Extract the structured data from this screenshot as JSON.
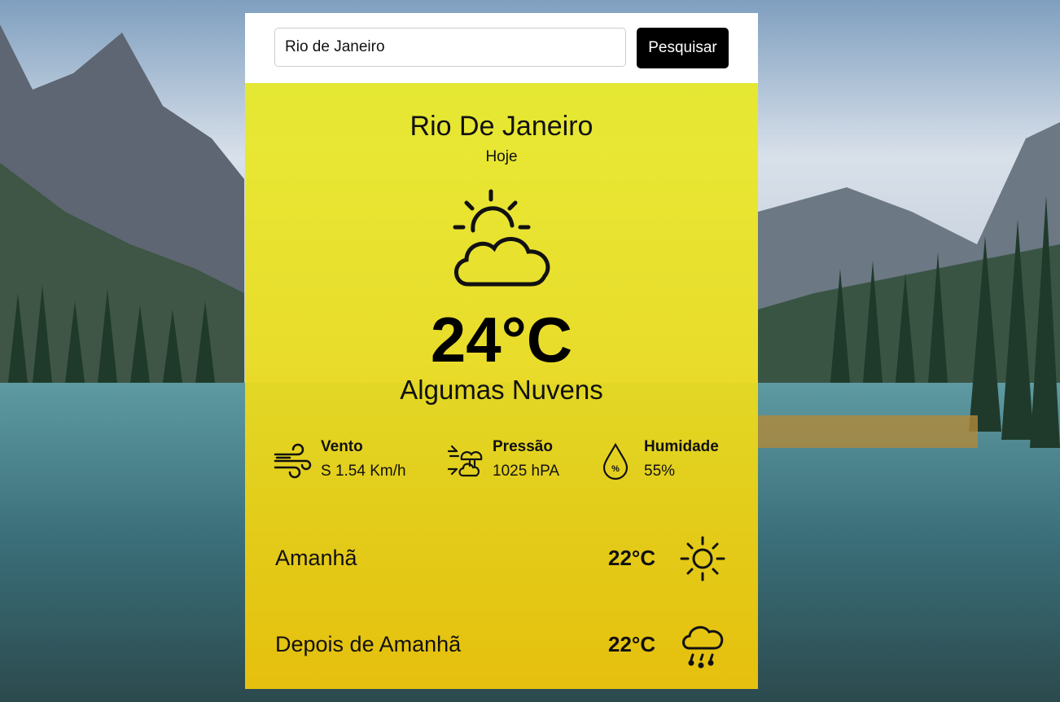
{
  "search": {
    "value": "Rio de Janeiro",
    "button_label": "Pesquisar"
  },
  "current": {
    "city": "Rio De Janeiro",
    "day": "Hoje",
    "icon": "partly-cloudy-icon",
    "temperature": "24°C",
    "description": "Algumas Nuvens"
  },
  "stats": [
    {
      "icon": "wind-icon",
      "label": "Vento",
      "value": "S 1.54 Km/h"
    },
    {
      "icon": "pressure-icon",
      "label": "Pressão",
      "value": "1025 hPA"
    },
    {
      "icon": "humidity-icon",
      "label": "Humidade",
      "value": "55%"
    }
  ],
  "forecast": [
    {
      "day": "Amanhã",
      "temp": "22°C",
      "icon": "sun-icon"
    },
    {
      "day": "Depois de Amanhã",
      "temp": "22°C",
      "icon": "rain-cloud-icon"
    }
  ],
  "colors": {
    "card_top": "#e8ee28",
    "card_bottom": "#f0c60a",
    "button": "#000000"
  }
}
